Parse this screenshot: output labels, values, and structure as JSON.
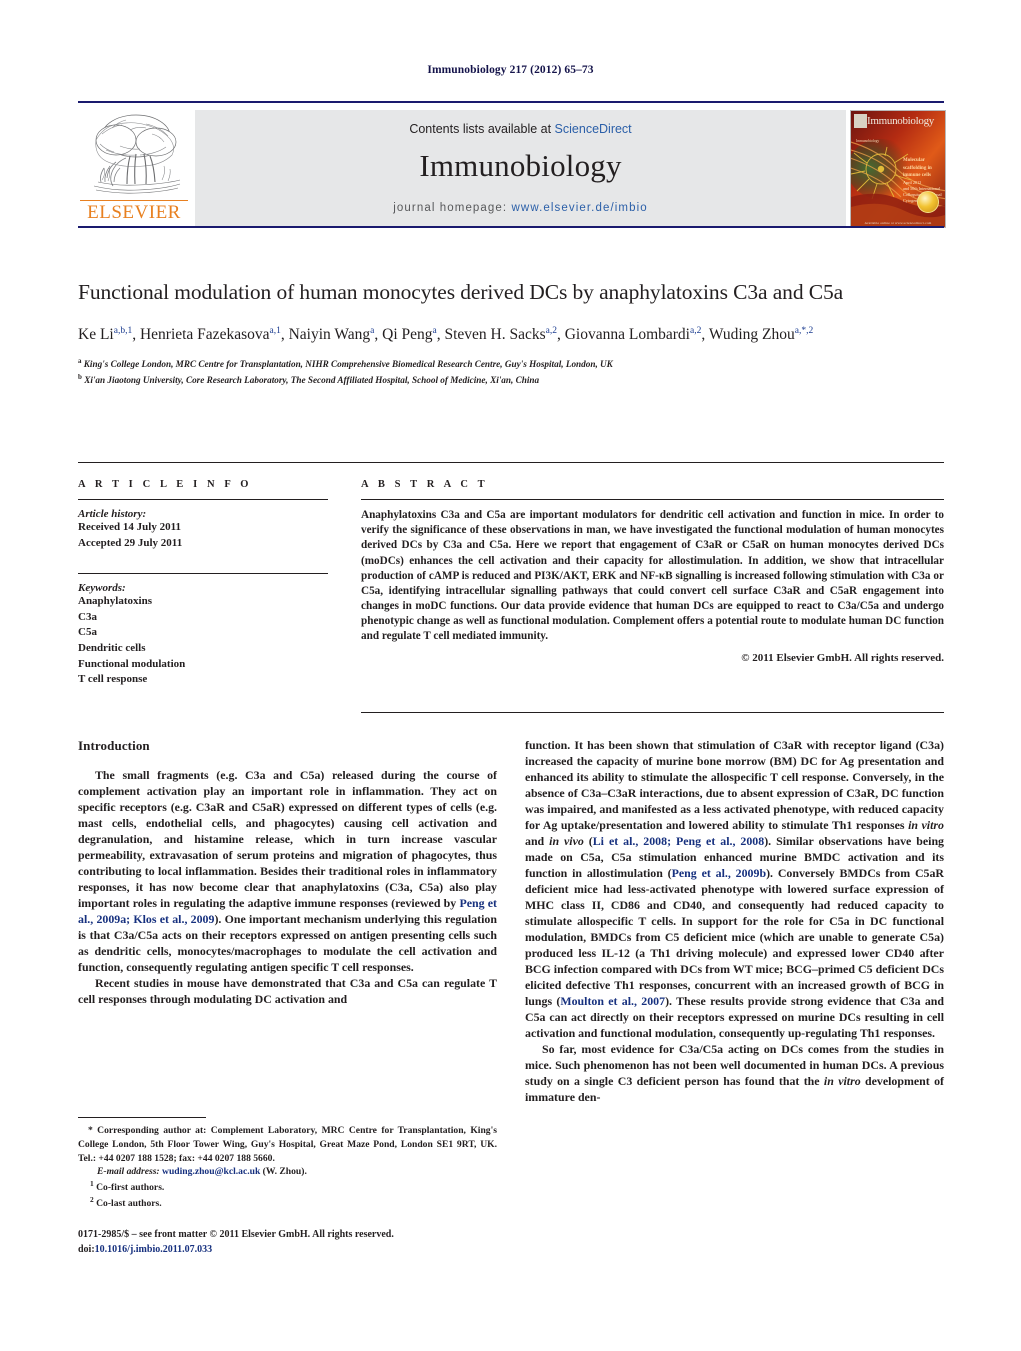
{
  "running_head": "Immunobiology 217 (2012) 65–73",
  "masthead": {
    "contents_prefix": "Contents lists available at ",
    "sciencedirect": "ScienceDirect",
    "journal_name": "Immunobiology",
    "homepage_prefix": "journal homepage: ",
    "homepage_url": "www.elsevier.de/imbio",
    "publisher_logo_text": "ELSEVIER",
    "cover": {
      "title": "Immunobiology",
      "blurb_title": "Molecular scaffolding in immune cells",
      "blurb_sub": "April 2012",
      "blurb_note": "and 50th International Colloquium on Animal Cytogenetics",
      "side_text": "Immunobiology",
      "issue_text": "Volume 217\nNumber 1\nJanuary 2012\nISSN 0171-2985",
      "footer": "Available online at www.sciencedirect.com"
    }
  },
  "article": {
    "title": "Functional modulation of human monocytes derived DCs by anaphylatoxins C3a and C5a",
    "authors": [
      {
        "name": "Ke Li",
        "sup": "a,b,1"
      },
      {
        "name": "Henrieta Fazekasova",
        "sup": "a,1"
      },
      {
        "name": "Naiyin Wang",
        "sup": "a"
      },
      {
        "name": "Qi Peng",
        "sup": "a"
      },
      {
        "name": "Steven H. Sacks",
        "sup": "a,2"
      },
      {
        "name": "Giovanna Lombardi",
        "sup": "a,2"
      },
      {
        "name": "Wuding Zhou",
        "sup": "a,*,2"
      }
    ],
    "affiliations": [
      {
        "marker": "a",
        "text": "King's College London, MRC Centre for Transplantation, NIHR Comprehensive Biomedical Research Centre, Guy's Hospital, London, UK"
      },
      {
        "marker": "b",
        "text": "Xi'an Jiaotong University, Core Research Laboratory, The Second Affiliated Hospital, School of Medicine, Xi'an, China"
      }
    ]
  },
  "article_info": {
    "heading": "A R T I C L E    I N F O",
    "history_label": "Article history:",
    "history": [
      "Received 14 July 2011",
      "Accepted 29 July 2011"
    ],
    "keywords_label": "Keywords:",
    "keywords": [
      "Anaphylatoxins",
      "C3a",
      "C5a",
      "Dendritic cells",
      "Functional modulation",
      "T cell response"
    ]
  },
  "abstract": {
    "heading": "A B S T R A C T",
    "text": "Anaphylatoxins C3a and C5a are important modulators for dendritic cell activation and function in mice. In order to verify the significance of these observations in man, we have investigated the functional modulation of human monocytes derived DCs by C3a and C5a. Here we report that engagement of C3aR or C5aR on human monocytes derived DCs (moDCs) enhances the cell activation and their capacity for allostimulation. In addition, we show that intracellular production of cAMP is reduced and PI3K/AKT, ERK and NF-κB signalling is increased following stimulation with C3a or C5a, identifying intracellular signalling pathways that could convert cell surface C3aR and C5aR engagement into changes in moDC functions. Our data provide evidence that human DCs are equipped to react to C3a/C5a and undergo phenotypic change as well as functional modulation. Complement offers a potential route to modulate human DC function and regulate T cell mediated immunity.",
    "copyright": "© 2011 Elsevier GmbH. All rights reserved."
  },
  "body": {
    "intro_heading": "Introduction",
    "left_paragraphs": [
      {
        "segments": [
          {
            "t": "The small fragments (e.g. C3a and C5a) released during the course of complement activation play an important role in inflammation. They act on specific receptors (e.g. C3aR and C5aR) expressed on different types of cells (e.g. mast cells, endothelial cells, and phagocytes) causing cell activation and degranulation, and histamine release, which in turn increase vascular permeability, extravasation of serum proteins and migration of phagocytes, thus contributing to local inflammation. Besides their traditional roles in inflammatory responses, it has now become clear that anaphylatoxins (C3a, C5a) also play important roles in regulating the adaptive immune responses (reviewed by ",
            "style": "plain"
          },
          {
            "t": "Peng et al., 2009a; Klos et al., 2009",
            "style": "cite"
          },
          {
            "t": "). One important mechanism underlying this regulation is that C3a/C5a acts on their receptors expressed on antigen presenting cells such as dendritic cells, monocytes/macrophages to modulate the cell activation and function, consequently regulating antigen specific T cell responses.",
            "style": "plain"
          }
        ]
      },
      {
        "segments": [
          {
            "t": "Recent studies in mouse have demonstrated that C3a and C5a can regulate T cell responses through modulating DC activation and",
            "style": "plain"
          }
        ]
      }
    ],
    "right_paragraphs": [
      {
        "segments": [
          {
            "t": "function. It has been shown that stimulation of C3aR with receptor ligand (C3a) increased the capacity of murine bone morrow (BM) DC for Ag presentation and enhanced its ability to stimulate the allospecific T cell response. Conversely, in the absence of C3a–C3aR interactions, due to absent expression of C3aR, DC function was impaired, and manifested as a less activated phenotype, with reduced capacity for Ag uptake/presentation and lowered ability to stimulate Th1 responses ",
            "style": "plain"
          },
          {
            "t": "in vitro",
            "style": "italic"
          },
          {
            "t": " and ",
            "style": "plain"
          },
          {
            "t": "in vivo",
            "style": "italic"
          },
          {
            "t": " (",
            "style": "plain"
          },
          {
            "t": "Li et al., 2008; Peng et al., 2008",
            "style": "cite"
          },
          {
            "t": "). Similar observations have being made on C5a, C5a stimulation enhanced murine BMDC activation and its function in allostimulation (",
            "style": "plain"
          },
          {
            "t": "Peng et al., 2009b",
            "style": "cite"
          },
          {
            "t": "). Conversely BMDCs from C5aR deficient mice had less-activated phenotype with lowered surface expression of MHC class II, CD86 and CD40, and consequently had reduced capacity to stimulate allospecific T cells. In support for the role for C5a in DC functional modulation, BMDCs from C5 deficient mice (which are unable to generate C5a) produced less IL-12 (a Th1 driving molecule) and expressed lower CD40 after BCG infection compared with DCs from WT mice; BCG–primed C5 deficient DCs elicited defective Th1 responses, concurrent with an increased growth of BCG in lungs (",
            "style": "plain"
          },
          {
            "t": "Moulton et al., 2007",
            "style": "cite"
          },
          {
            "t": "). These results provide strong evidence that C3a and C5a can act directly on their receptors expressed on murine DCs resulting in cell activation and functional modulation, consequently up-regulating Th1 responses.",
            "style": "plain"
          }
        ]
      },
      {
        "segments": [
          {
            "t": "So far, most evidence for C3a/C5a acting on DCs comes from the studies in mice. Such phenomenon has not been well documented in human DCs. A previous study on a single C3 deficient person has found that the ",
            "style": "plain"
          },
          {
            "t": "in vitro",
            "style": "italic"
          },
          {
            "t": " development of immature den-",
            "style": "plain"
          }
        ]
      }
    ]
  },
  "footnotes": {
    "corresponding": "* Corresponding author at: Complement Laboratory, MRC Centre for Transplantation, King's College London, 5th Floor Tower Wing, Guy's Hospital, Great Maze Pond, London SE1 9RT, UK. Tel.: +44 0207 188 1528; fax: +44 0207 188 5660.",
    "email_label": "E-mail address:",
    "email": "wuding.zhou@kcl.ac.uk",
    "email_suffix": " (W. Zhou).",
    "notes": [
      {
        "marker": "1",
        "text": "Co-first authors."
      },
      {
        "marker": "2",
        "text": "Co-last authors."
      }
    ]
  },
  "imprint": {
    "line1": "0171-2985/$ – see front matter © 2011 Elsevier GmbH. All rights reserved.",
    "doi_label": "doi:",
    "doi": "10.1016/j.imbio.2011.07.033"
  }
}
